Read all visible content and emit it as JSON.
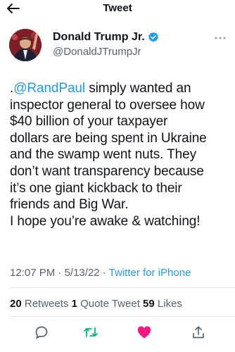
{
  "header": {
    "title": "Tweet",
    "back_icon": "arrow-left-icon"
  },
  "author": {
    "display_name": "Donald Trump Jr.",
    "handle": "@DonaldJTrumpJr",
    "verified_icon": "verified-badge-icon",
    "verified_color": "#1d9bf0"
  },
  "tweet": {
    "prefix": ".",
    "mention": "@RandPaul",
    "body": " simply wanted an\ninspector general to oversee how\n$40 billion of your taxpayer\ndollars are being spent in Ukraine\nand the swamp went nuts. They\ndon’t want transparency because\nit’s one giant kickback to their\nfriends and Big War.\nI hope you’re awake & watching!"
  },
  "meta": {
    "time": "12:07 PM",
    "separator": " · ",
    "date": "5/13/22",
    "source": "Twitter for iPhone"
  },
  "stats": {
    "retweets_count": "20",
    "retweets_label": "Retweets",
    "quotes_count": "1",
    "quotes_label": "Quote Tweet",
    "likes_count": "59",
    "likes_label": "Likes"
  },
  "actions": {
    "reply_icon": "reply-icon",
    "retweet_icon": "retweet-icon",
    "retweet_color": "#00ba7c",
    "like_icon": "heart-icon",
    "like_color": "#f91880",
    "share_icon": "share-icon"
  },
  "colors": {
    "accent": "#1d9bf0",
    "muted": "#536471",
    "text": "#0f1419"
  }
}
